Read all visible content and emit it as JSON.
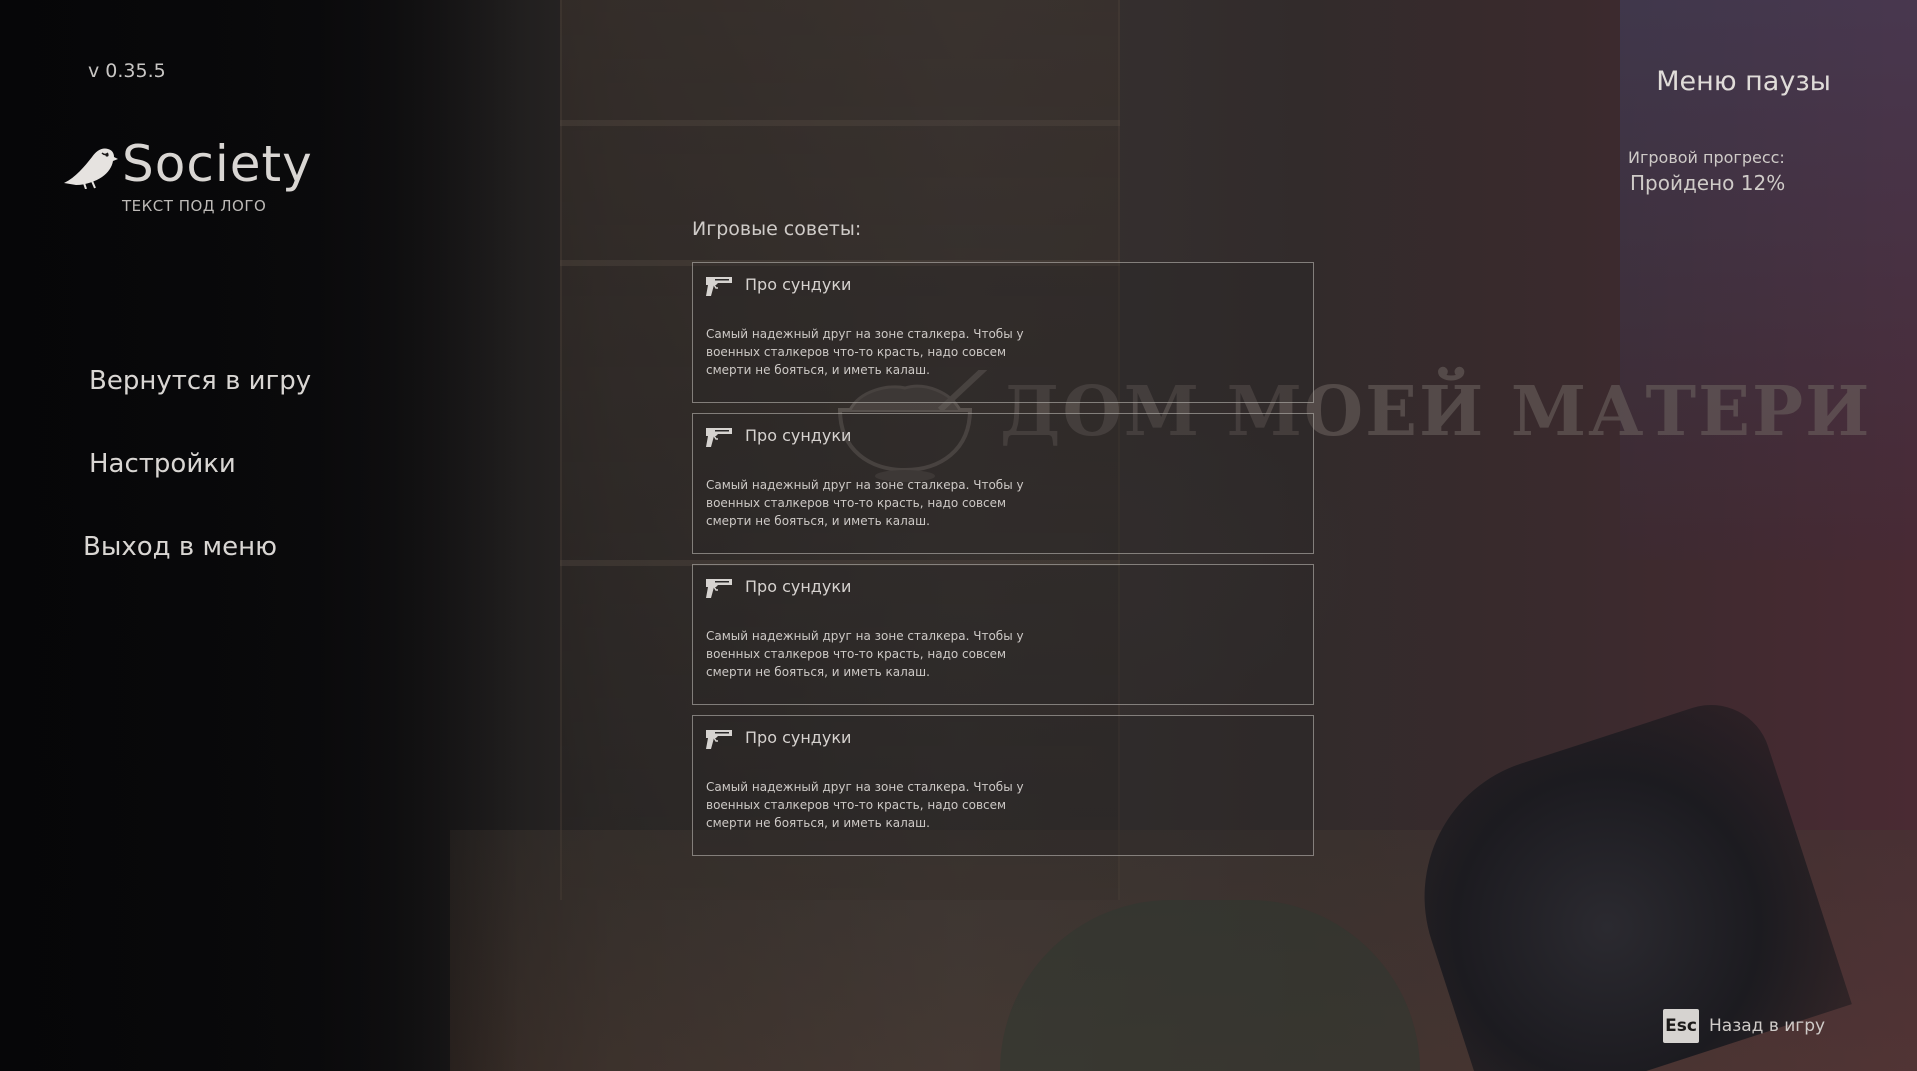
{
  "version": "v 0.35.5",
  "logo": {
    "title": "Society",
    "subtitle": "ТЕКСТ ПОД ЛОГО",
    "icon": "bird-logo-icon"
  },
  "menu": {
    "items": [
      {
        "label": "Вернутся в игру"
      },
      {
        "label": "Настройки"
      },
      {
        "label": "Выход в меню"
      }
    ]
  },
  "header": {
    "title": "Меню паузы",
    "progress_label": "Игровой прогресс:",
    "progress_text": "Пройдено 12%",
    "progress_value": 12
  },
  "watermark": {
    "text": "ДОМ МОЕЙ МАТЕРИ",
    "icon": "bowl-spoon-icon"
  },
  "tips": {
    "heading": "Игровые советы:",
    "items": [
      {
        "icon": "pistol-icon",
        "title": "Про сундуки",
        "text": "Самый надежный друг на зоне сталкера. Чтобы у военных сталкеров что-то красть, надо совсем смерти не бояться, и иметь калаш."
      },
      {
        "icon": "pistol-icon",
        "title": "Про сундуки",
        "text": "Самый надежный друг на зоне сталкера. Чтобы у военных сталкеров что-то красть, надо совсем смерти не бояться, и иметь калаш."
      },
      {
        "icon": "pistol-icon",
        "title": "Про сундуки",
        "text": "Самый надежный друг на зоне сталкера. Чтобы у военных сталкеров что-то красть, надо совсем смерти не бояться, и иметь калаш."
      },
      {
        "icon": "pistol-icon",
        "title": "Про сундуки",
        "text": "Самый надежный друг на зоне сталкера. Чтобы у военных сталкеров что-то красть, надо совсем смерти не бояться, и иметь калаш."
      }
    ]
  },
  "footer": {
    "key": "Esc",
    "label": "Назад в игру"
  }
}
